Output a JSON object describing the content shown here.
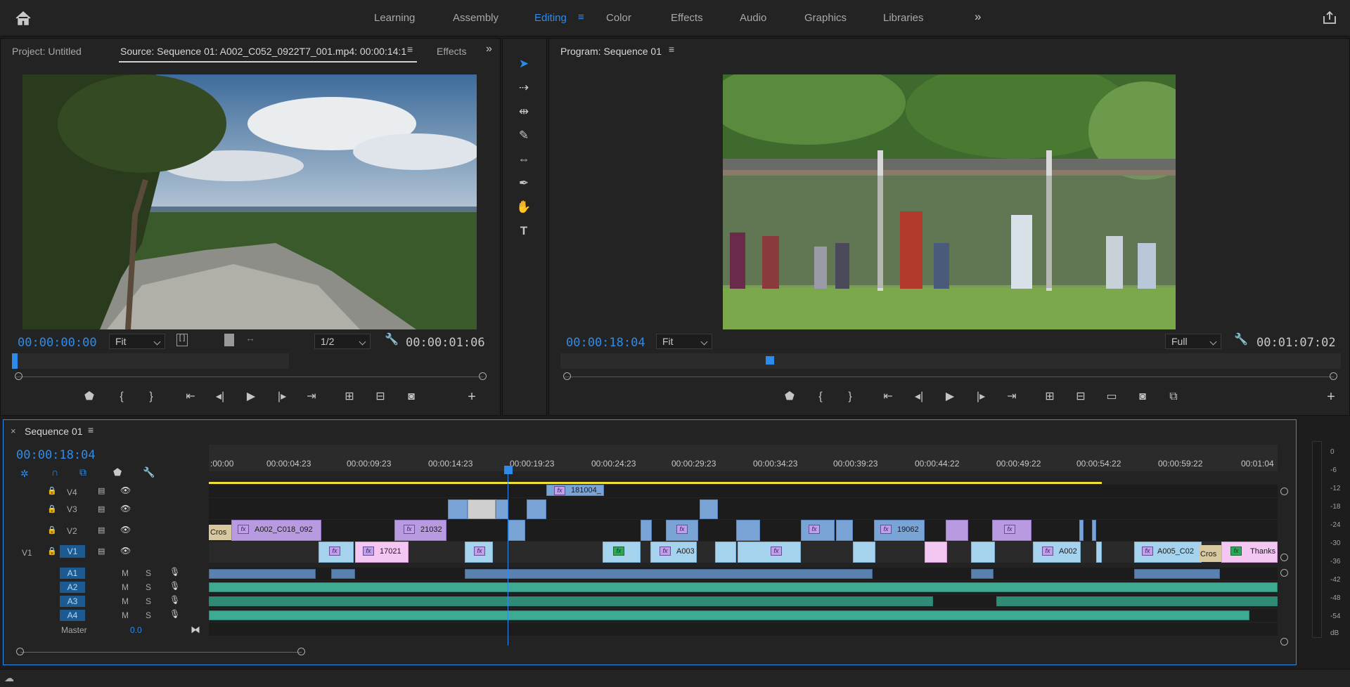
{
  "workspaces": [
    "Learning",
    "Assembly",
    "Editing",
    "Color",
    "Effects",
    "Audio",
    "Graphics",
    "Libraries"
  ],
  "active_workspace": "Editing",
  "source_panel": {
    "tabs": [
      "Project: Untitled",
      "Source: Sequence 01: A002_C052_0922T7_001.mp4: 00:00:14:1",
      "Effects"
    ],
    "timecode": "00:00:00:00",
    "zoom": "Fit",
    "resolution": "1/2",
    "duration": "00:00:01:06",
    "playhead_fraction": 0.0
  },
  "program_panel": {
    "title": "Program: Sequence 01",
    "timecode": "00:00:18:04",
    "zoom": "Fit",
    "resolution": "Full",
    "duration": "00:01:07:02",
    "playhead_fraction": 0.27
  },
  "timeline": {
    "title": "Sequence 01",
    "timecode": "00:00:18:04",
    "ruler_labels": [
      ":00:00",
      "00:00:04:23",
      "00:00:09:23",
      "00:00:14:23",
      "00:00:19:23",
      "00:00:24:23",
      "00:00:29:23",
      "00:00:34:23",
      "00:00:39:23",
      "00:00:44:22",
      "00:00:49:22",
      "00:00:54:22",
      "00:00:59:22",
      "00:01:04"
    ],
    "video_tracks": [
      "V4",
      "V3",
      "V2",
      "V1"
    ],
    "audio_tracks": [
      "A1",
      "A2",
      "A3",
      "A4"
    ],
    "source_patch": "V1",
    "master_label": "Master",
    "master_value": "0.0",
    "mute_label": "M",
    "solo_label": "S",
    "clip_labels": {
      "v4_top": "181004_",
      "v2_a": "Cros",
      "v2_b": "A002_C018_092",
      "v2_c": "21032",
      "v2_d": "19062",
      "v1_a": "17021",
      "v1_b": "A003",
      "v1_c": "A002",
      "v1_d": "A005_C02",
      "v1_e": "Cros",
      "v1_f": "Thanks"
    },
    "fx_label": "fx"
  },
  "meter_labels": [
    "0",
    "-6",
    "-12",
    "-18",
    "-24",
    "-30",
    "-36",
    "-42",
    "-48",
    "-54",
    "dB"
  ],
  "colors": {
    "accent": "#2d8ceb",
    "video_clip": "#a5d3ee",
    "nested_clip": "#b79ae0",
    "audio_clip": "#3eaa92",
    "work_area": "#f0e030"
  }
}
